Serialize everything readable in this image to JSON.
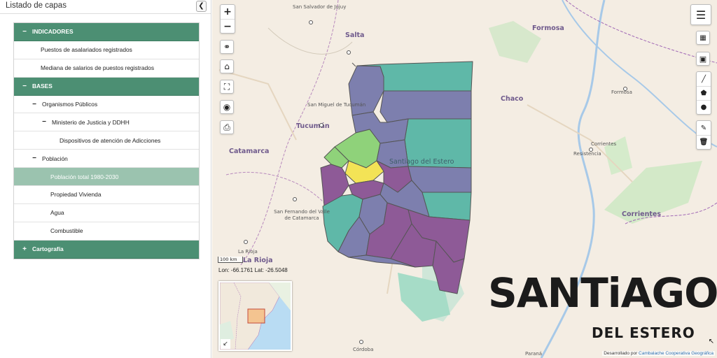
{
  "panel": {
    "title": "Listado de capas",
    "collapse_icon": "chevron-left-icon",
    "tree": [
      {
        "type": "group",
        "toggle": "−",
        "label": "INDICADORES",
        "level": "lvl0"
      },
      {
        "type": "leaf",
        "label": "Puestos de asalariados registrados",
        "level": "leaf1"
      },
      {
        "type": "leaf",
        "label": "Mediana de salarios de puestos registrados",
        "level": "leaf1"
      },
      {
        "type": "group",
        "toggle": "−",
        "label": "BASES",
        "level": "lvl0"
      },
      {
        "type": "folder",
        "toggle": "−",
        "label": "Organismos Públicos",
        "level": "lvl1"
      },
      {
        "type": "folder",
        "toggle": "−",
        "label": "Ministerio de Justicia y DDHH",
        "level": "lvl2"
      },
      {
        "type": "leaf",
        "label": "Dispositivos de atención de Adicciones",
        "level": "lvl3"
      },
      {
        "type": "folder",
        "toggle": "−",
        "label": "Población",
        "level": "lvl1"
      },
      {
        "type": "leaf",
        "label": "Población total 1980-2030",
        "level": "leaf2",
        "selected": true
      },
      {
        "type": "leaf",
        "label": "Propiedad Vivienda",
        "level": "leaf2"
      },
      {
        "type": "leaf",
        "label": "Agua",
        "level": "leaf2"
      },
      {
        "type": "leaf",
        "label": "Combustible",
        "level": "leaf2"
      },
      {
        "type": "group",
        "toggle": "+",
        "label": "Cartografía",
        "level": "lvl0"
      }
    ]
  },
  "map": {
    "labels": {
      "san_salvador": "San Salvador de Jujuy",
      "salta": "Salta",
      "formosa_prov": "Formosa",
      "formosa_city": "Formosa",
      "chaco": "Chaco",
      "smt": "San Miguel de Tucumán",
      "tucuman": "Tucumán",
      "catamarca": "Catamarca",
      "santiago": "Santiago del Estero",
      "resistencia": "Resistencia",
      "corrientes_city": "Corrientes",
      "corrientes_prov": "Corrientes",
      "sfvc": "San Fernando del Valle de Catamarca",
      "la_rioja_city": "La Rioja",
      "la_rioja_prov": "La Rioja",
      "cordoba": "Córdoba",
      "parana": "Paraná"
    },
    "scale": "100 km",
    "coords": "Lon: -66.1761 Lat: -26.5048",
    "attribution_text": "Desarrollado por ",
    "attribution_link": "Cambalache Cooperativa Geográfica",
    "logo_main": "SANTiAGO",
    "logo_sub": "DEL ESTERO",
    "colors": {
      "teal": "#5fb8a8",
      "slate": "#7d7fae",
      "purple": "#8e5a97",
      "green": "#8fd27a",
      "yellow": "#f3e356",
      "map_bg": "#f4ede3"
    },
    "controls": {
      "zoom_in": "+",
      "zoom_out": "−",
      "icons": [
        "home-icon",
        "fullscreen-icon",
        "globe-icon",
        "print-icon",
        "layers-icon",
        "table-icon",
        "draw-line-icon",
        "draw-polygon-icon",
        "marker-icon",
        "edit-icon",
        "trash-icon"
      ]
    }
  }
}
